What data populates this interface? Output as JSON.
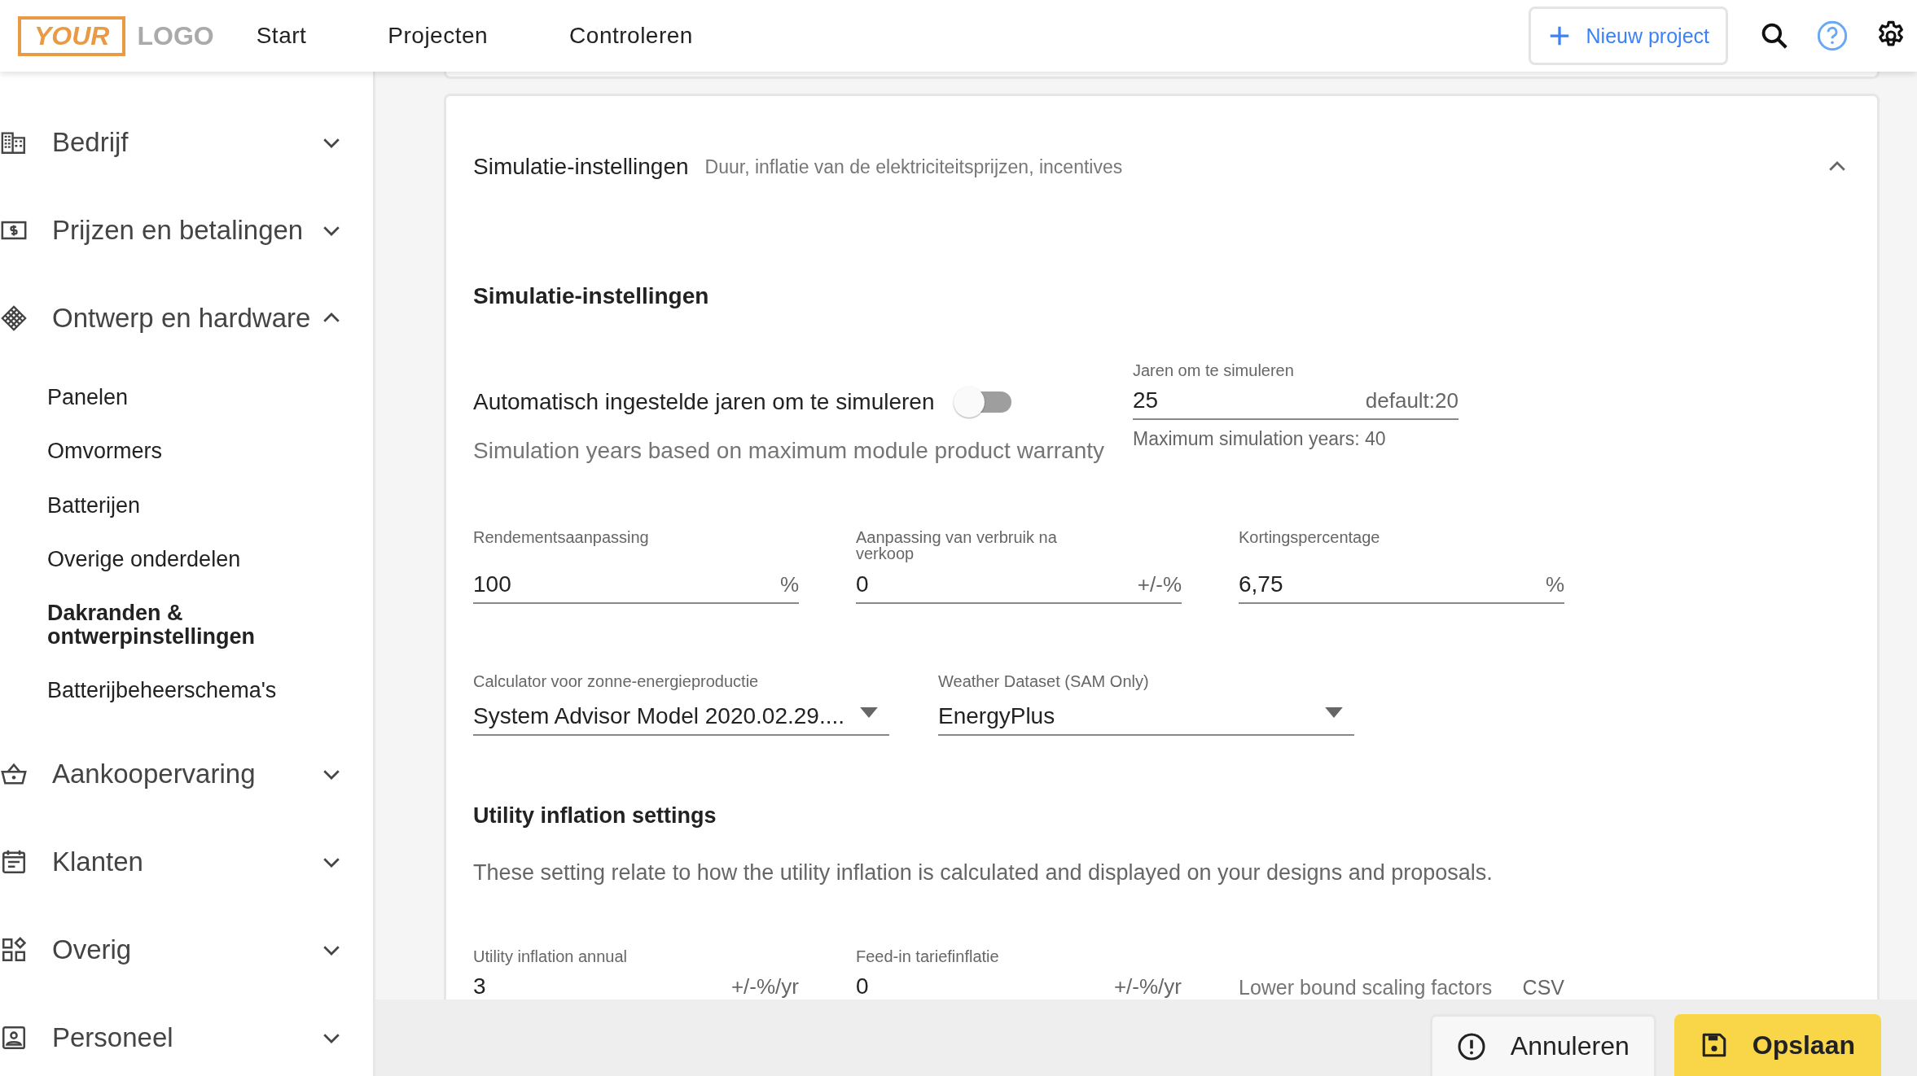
{
  "header": {
    "logo": {
      "boxed": "YOUR",
      "plain": "LOGO"
    },
    "nav": [
      "Start",
      "Projecten",
      "Controleren"
    ],
    "new_project_button": "Nieuw project"
  },
  "sidebar": {
    "items": [
      {
        "label": "Bedrijf",
        "expanded": false
      },
      {
        "label": "Prijzen en betalingen",
        "expanded": false
      },
      {
        "label": "Ontwerp en hardware",
        "expanded": true,
        "children": [
          {
            "label": "Panelen",
            "selected": false
          },
          {
            "label": "Omvormers",
            "selected": false
          },
          {
            "label": "Batterijen",
            "selected": false
          },
          {
            "label": "Overige onderdelen",
            "selected": false
          },
          {
            "label": "Dakranden & ontwerpinstellingen",
            "selected": true
          },
          {
            "label": "Batterijbeheerschema's",
            "selected": false
          }
        ]
      },
      {
        "label": "Aankoopervaring",
        "expanded": false
      },
      {
        "label": "Klanten",
        "expanded": false
      },
      {
        "label": "Overig",
        "expanded": false
      },
      {
        "label": "Personeel",
        "expanded": false
      }
    ]
  },
  "card": {
    "title": "Simulatie-instellingen",
    "subtitle": "Duur, inflatie van de elektriciteitsprijzen, incentives",
    "expanded": true,
    "section_title": "Simulatie-instellingen",
    "toggle": {
      "label": "Automatisch ingestelde jaren om te simuleren",
      "on": false,
      "help": "Simulation years based on maximum module product warranty"
    },
    "years_field": {
      "label": "Jaren om te simuleren",
      "value": "25",
      "suffix": "default:20",
      "hint": "Maximum simulation years: 40"
    },
    "fields": [
      {
        "label": "Rendementsaanpassing",
        "value": "100",
        "suffix": "%"
      },
      {
        "label": "Aanpassing van verbruik na verkoop",
        "value": "0",
        "suffix": "+/-%"
      },
      {
        "label": "Kortingspercentage",
        "value": "6,75",
        "suffix": "%"
      }
    ],
    "selects": [
      {
        "label": "Calculator voor zonne-energieproductie",
        "value": "System Advisor Model 2020.02.29...."
      },
      {
        "label": "Weather Dataset (SAM Only)",
        "value": "EnergyPlus"
      }
    ],
    "utility": {
      "title": "Utility inflation settings",
      "description": "These setting relate to how the utility inflation is calculated and displayed on your designs and proposals.",
      "fields": [
        {
          "label": "Utility inflation annual",
          "value": "3",
          "suffix": "+/-%/yr"
        },
        {
          "label": "Feed-in tariefinflatie",
          "value": "0",
          "suffix": "+/-%/yr"
        }
      ],
      "csv_field": {
        "placeholder": "Lower bound scaling factors",
        "suffix": "CSV"
      }
    }
  },
  "footer": {
    "cancel_button": "Annuleren",
    "save_button": "Opslaan"
  }
}
